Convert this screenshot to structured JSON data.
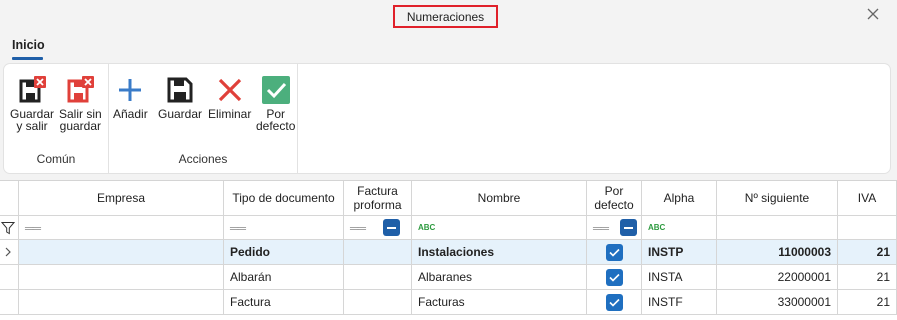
{
  "window": {
    "title": "Numeraciones"
  },
  "ribbon": {
    "tab": "Inicio",
    "groups": [
      {
        "label": "Común",
        "buttons": [
          {
            "label": "Guardar\ny salir",
            "icon": "save-close-icon"
          },
          {
            "label": "Salir sin\nguardar",
            "icon": "exit-no-save-icon"
          }
        ]
      },
      {
        "label": "Acciones",
        "buttons": [
          {
            "label": "Añadir",
            "icon": "plus-icon"
          },
          {
            "label": "Guardar",
            "icon": "save-icon"
          },
          {
            "label": "Eliminar",
            "icon": "delete-x-icon"
          },
          {
            "label": "Por\ndefecto",
            "icon": "checkmark-icon"
          }
        ]
      }
    ]
  },
  "grid": {
    "columns": [
      "Empresa",
      "Tipo de documento",
      "Factura\nproforma",
      "Nombre",
      "Por\ndefecto",
      "Alpha",
      "Nº siguiente",
      "IVA"
    ],
    "filter": {
      "abc_label": "ABC"
    },
    "rows": [
      {
        "empresa": "",
        "tipo": "Pedido",
        "proforma": "",
        "nombre": "Instalaciones",
        "por_defecto": true,
        "alpha": "INSTP",
        "siguiente": "11000003",
        "iva": "21",
        "selected": true
      },
      {
        "empresa": "",
        "tipo": "Albarán",
        "proforma": "",
        "nombre": "Albaranes",
        "por_defecto": true,
        "alpha": "INSTA",
        "siguiente": "22000001",
        "iva": "21",
        "selected": false
      },
      {
        "empresa": "",
        "tipo": "Factura",
        "proforma": "",
        "nombre": "Facturas",
        "por_defecto": true,
        "alpha": "INSTF",
        "siguiente": "33000001",
        "iva": "21",
        "selected": false
      }
    ]
  },
  "colors": {
    "accent": "#1f5fa8",
    "highlight": "#e0202a",
    "selected_row": "#e6f2fb",
    "delete_red": "#e0403a",
    "default_green": "#4caf7d"
  }
}
